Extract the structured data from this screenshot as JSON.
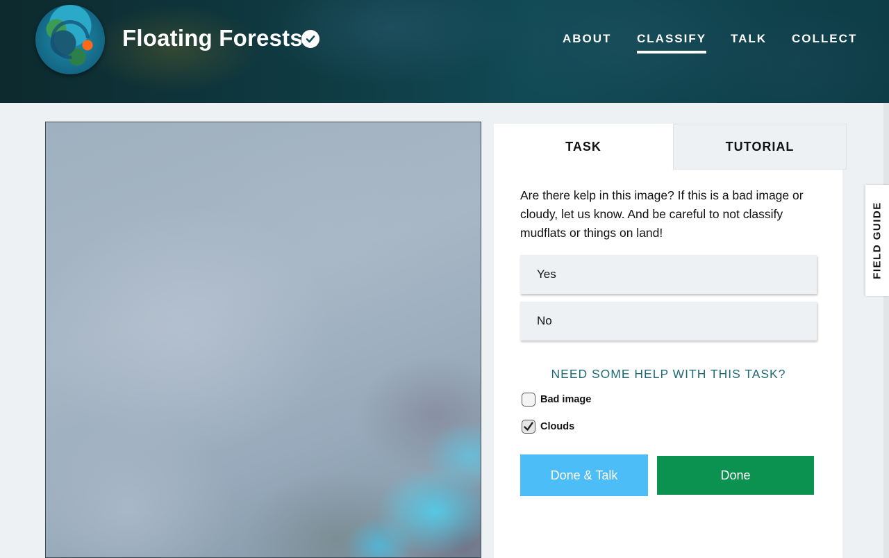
{
  "header": {
    "title": "Floating Forests",
    "nav": [
      {
        "label": "ABOUT",
        "active": false
      },
      {
        "label": "CLASSIFY",
        "active": true
      },
      {
        "label": "TALK",
        "active": false
      },
      {
        "label": "COLLECT",
        "active": false
      }
    ]
  },
  "panel": {
    "tabs": {
      "task": "TASK",
      "tutorial": "TUTORIAL"
    },
    "active_tab": "TASK",
    "question": "Are there kelp in this image? If this is a bad image or cloudy, let us know. And be careful to not classify mudflats or things on land!",
    "answers": {
      "yes": "Yes",
      "no": "No"
    },
    "help_link": "NEED SOME HELP WITH THIS TASK?",
    "checkboxes": {
      "bad_image": {
        "label": "Bad image",
        "checked": false
      },
      "clouds": {
        "label": "Clouds",
        "checked": true
      }
    },
    "buttons": {
      "done_talk": "Done & Talk",
      "done": "Done"
    }
  },
  "field_guide": {
    "label": "FIELD GUIDE"
  },
  "colors": {
    "accent_blue": "#4dbdf7",
    "done_green": "#0c9250",
    "help_teal": "#1e6a75"
  },
  "icons": {
    "verified": "check-circle-icon",
    "logo": "floating-forests-logo"
  }
}
